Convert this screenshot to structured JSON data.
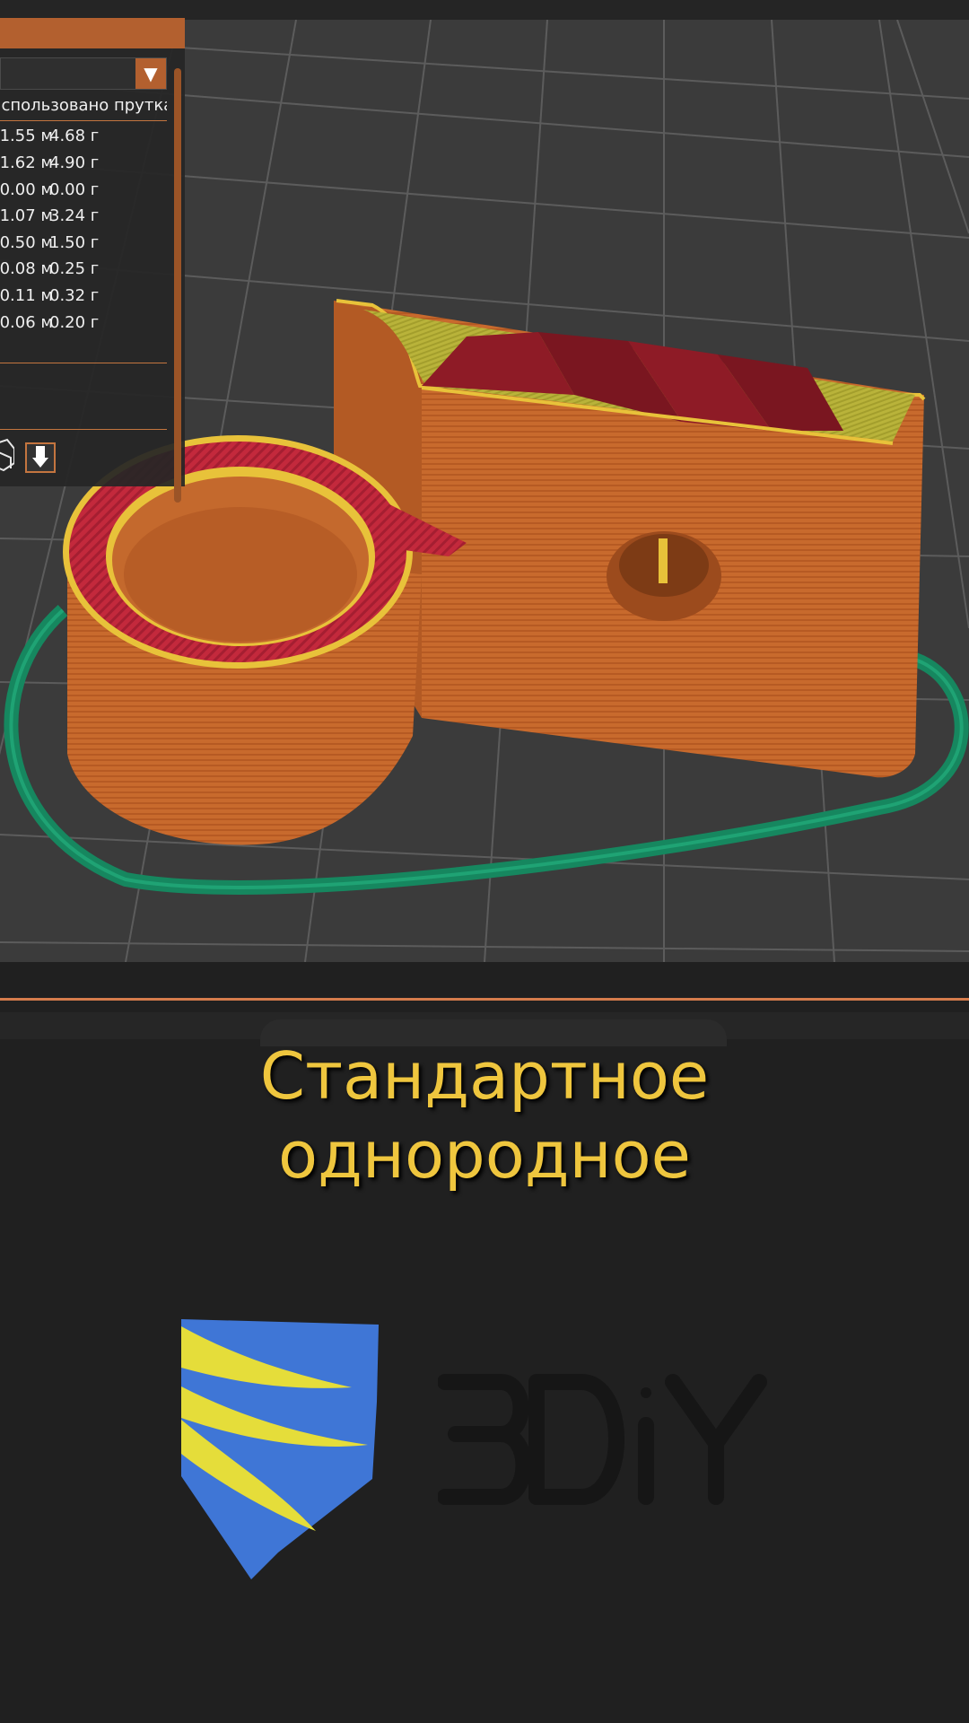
{
  "viewer": {
    "legend": {
      "column_header": "Использовано прутка",
      "rows": [
        {
          "length": "1.55 м",
          "weight": "4.68 г"
        },
        {
          "length": "1.62 м",
          "weight": "4.90 г"
        },
        {
          "length": "0.00 м",
          "weight": "0.00 г"
        },
        {
          "length": "1.07 м",
          "weight": "3.24 г"
        },
        {
          "length": "0.50 м",
          "weight": "1.50 г"
        },
        {
          "length": "0.08 м",
          "weight": "0.25 г"
        },
        {
          "length": "0.11 м",
          "weight": "0.32 г"
        },
        {
          "length": "0.06 м",
          "weight": "0.20 г"
        }
      ],
      "dropdown_icon": "triangle-down-icon",
      "toolbar_icons": [
        "cube-wireframe-icon",
        "download-arrow-icon"
      ]
    },
    "colors": {
      "accent": "#b3602f",
      "model": "#c96a2e",
      "top_infill": "#b8b43b",
      "solid_infill": "#c62f3d",
      "skirt": "#16875f",
      "perimeter_highlight": "#e8c23a"
    }
  },
  "caption": {
    "line1": "Стандартное",
    "line2": "однородное",
    "color": "#efc63e"
  },
  "brand": {
    "wordmark": "3DiY",
    "blue": "#3f76d6",
    "yellow": "#e5dd3a"
  }
}
